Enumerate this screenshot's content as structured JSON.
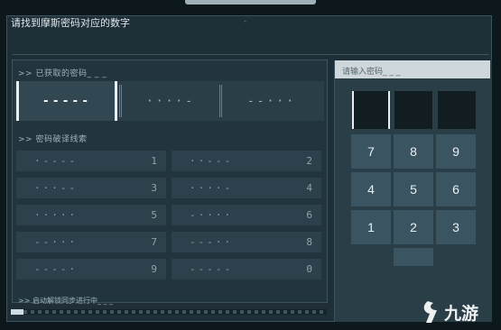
{
  "title": "请找到摩斯密码对应的数字",
  "title_tick": "-",
  "acquired": {
    "label": ">> 已获取的密码_ _ _",
    "slots": [
      "-----",
      "····-",
      "--···"
    ]
  },
  "clues": {
    "label": ">> 密码破译线索",
    "items": [
      {
        "code": "·----",
        "num": "1"
      },
      {
        "code": "··---",
        "num": "2"
      },
      {
        "code": "···--",
        "num": "3"
      },
      {
        "code": "····-",
        "num": "4"
      },
      {
        "code": "·····",
        "num": "5"
      },
      {
        "code": "-····",
        "num": "6"
      },
      {
        "code": "--···",
        "num": "7"
      },
      {
        "code": "---··",
        "num": "8"
      },
      {
        "code": "----·",
        "num": "9"
      },
      {
        "code": "-----",
        "num": "0"
      }
    ]
  },
  "status": ">> 启动解锁同步进行中_ _ _",
  "progress": 0.04,
  "input": {
    "placeholder": "请输入密码_ _ _"
  },
  "keypad": {
    "keys": [
      "7",
      "8",
      "9",
      "4",
      "5",
      "6",
      "1",
      "2",
      "3"
    ]
  },
  "watermark": "九游",
  "colors": {
    "panel": "#1e2f37",
    "key": "#3a5561",
    "accent": "#e6eef1"
  }
}
